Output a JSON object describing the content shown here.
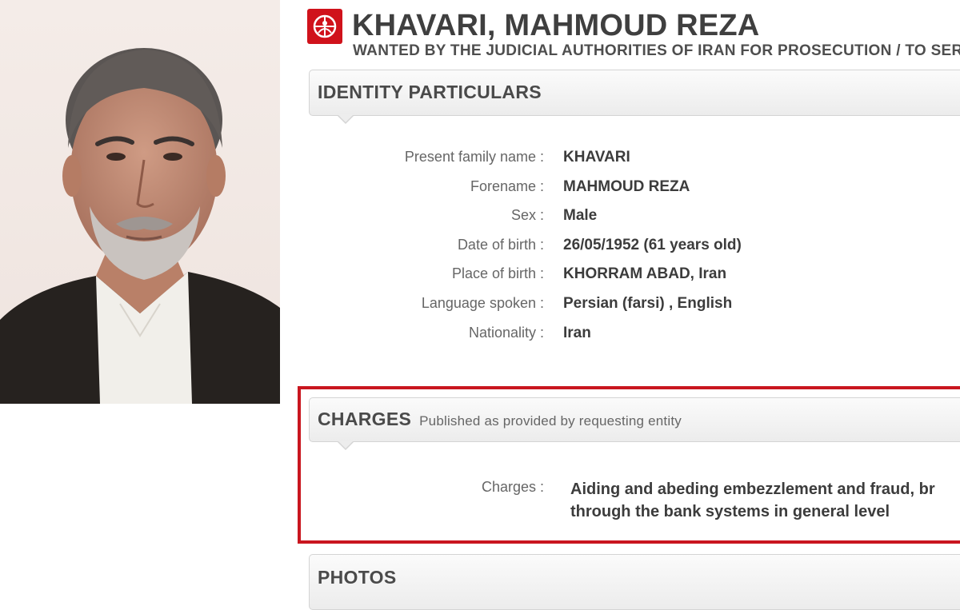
{
  "header": {
    "name": "KHAVARI, MAHMOUD REZA",
    "subtitle": "WANTED BY THE JUDICIAL AUTHORITIES OF IRAN FOR PROSECUTION / TO SERVE",
    "logo_icon": "interpol-emblem-icon",
    "logo_color": "#d0121b"
  },
  "identity": {
    "title": "IDENTITY PARTICULARS",
    "rows": [
      {
        "label": "Present family name",
        "value": "KHAVARI"
      },
      {
        "label": "Forename",
        "value": "MAHMOUD REZA"
      },
      {
        "label": "Sex",
        "value": "Male"
      },
      {
        "label": "Date of birth",
        "value": "26/05/1952 (61 years old)"
      },
      {
        "label": "Place of birth",
        "value": "KHORRAM ABAD, Iran"
      },
      {
        "label": "Language spoken",
        "value": "Persian (farsi) , English"
      },
      {
        "label": "Nationality",
        "value": "Iran"
      }
    ]
  },
  "charges": {
    "title": "CHARGES",
    "note": "Published as provided by requesting entity",
    "label": "Charges",
    "line1": "Aiding and abeding embezzlement and fraud, br",
    "line2": "through the bank systems in general level",
    "highlight_color": "#c9161f"
  },
  "photos": {
    "title": "PHOTOS"
  },
  "colon": ":"
}
